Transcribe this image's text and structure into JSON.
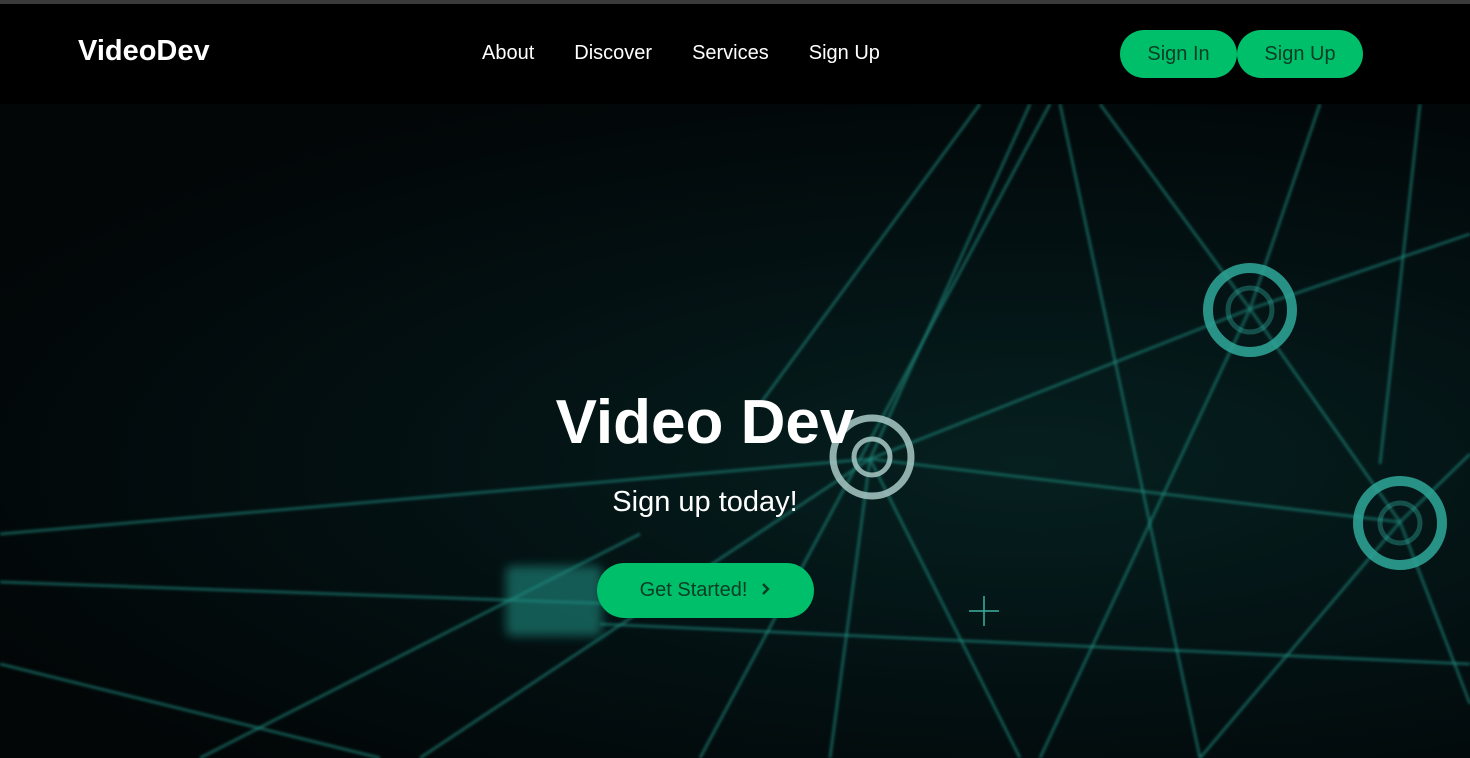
{
  "header": {
    "logo": "VideoDev",
    "nav": [
      {
        "label": "About"
      },
      {
        "label": "Discover"
      },
      {
        "label": "Services"
      },
      {
        "label": "Sign Up"
      }
    ],
    "signin_label": "Sign In",
    "signup_label": "Sign Up"
  },
  "hero": {
    "title": "Video Dev",
    "subtitle": "Sign up today!",
    "cta_label": "Get Started!",
    "cta_icon": "chevron-right-icon"
  },
  "colors": {
    "accent": "#00bf6a",
    "accent_text": "#0b3d24",
    "background": "#000000",
    "network_lines": "#1f8c80"
  }
}
